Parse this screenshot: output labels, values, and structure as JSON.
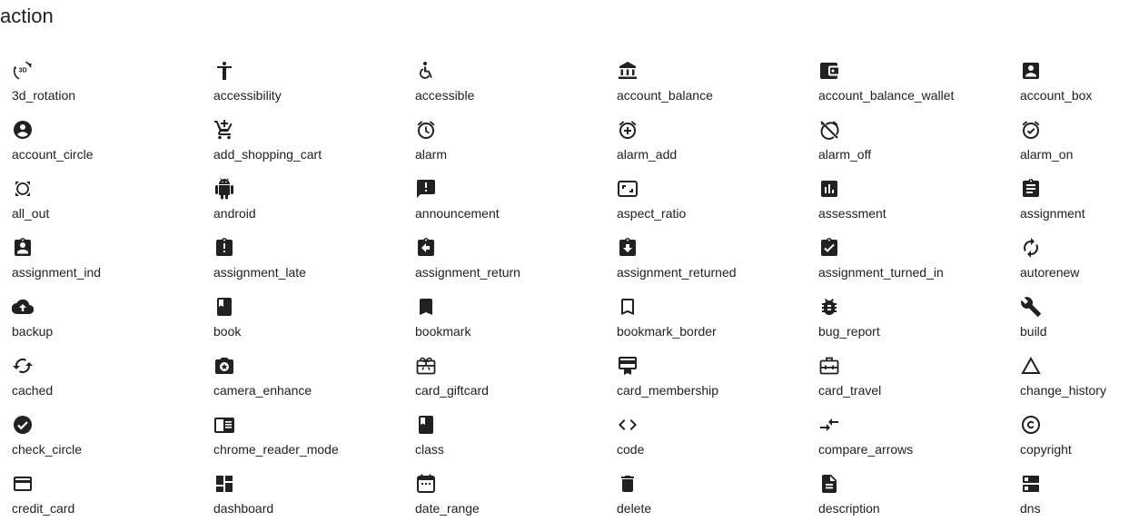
{
  "section": {
    "title": "action"
  },
  "icons": [
    {
      "label": "3d_rotation",
      "icon": "3d-rotation-icon"
    },
    {
      "label": "accessibility",
      "icon": "accessibility-icon"
    },
    {
      "label": "accessible",
      "icon": "accessible-icon"
    },
    {
      "label": "account_balance",
      "icon": "account-balance-icon"
    },
    {
      "label": "account_balance_wallet",
      "icon": "account-balance-wallet-icon"
    },
    {
      "label": "account_box",
      "icon": "account-box-icon"
    },
    {
      "label": "account_circle",
      "icon": "account-circle-icon"
    },
    {
      "label": "add_shopping_cart",
      "icon": "add-shopping-cart-icon"
    },
    {
      "label": "alarm",
      "icon": "alarm-icon"
    },
    {
      "label": "alarm_add",
      "icon": "alarm-add-icon"
    },
    {
      "label": "alarm_off",
      "icon": "alarm-off-icon"
    },
    {
      "label": "alarm_on",
      "icon": "alarm-on-icon"
    },
    {
      "label": "all_out",
      "icon": "all-out-icon"
    },
    {
      "label": "android",
      "icon": "android-icon"
    },
    {
      "label": "announcement",
      "icon": "announcement-icon"
    },
    {
      "label": "aspect_ratio",
      "icon": "aspect-ratio-icon"
    },
    {
      "label": "assessment",
      "icon": "assessment-icon"
    },
    {
      "label": "assignment",
      "icon": "assignment-icon"
    },
    {
      "label": "assignment_ind",
      "icon": "assignment-ind-icon"
    },
    {
      "label": "assignment_late",
      "icon": "assignment-late-icon"
    },
    {
      "label": "assignment_return",
      "icon": "assignment-return-icon"
    },
    {
      "label": "assignment_returned",
      "icon": "assignment-returned-icon"
    },
    {
      "label": "assignment_turned_in",
      "icon": "assignment-turned-in-icon"
    },
    {
      "label": "autorenew",
      "icon": "autorenew-icon"
    },
    {
      "label": "backup",
      "icon": "backup-icon"
    },
    {
      "label": "book",
      "icon": "book-icon"
    },
    {
      "label": "bookmark",
      "icon": "bookmark-icon"
    },
    {
      "label": "bookmark_border",
      "icon": "bookmark-border-icon"
    },
    {
      "label": "bug_report",
      "icon": "bug-report-icon"
    },
    {
      "label": "build",
      "icon": "build-icon"
    },
    {
      "label": "cached",
      "icon": "cached-icon"
    },
    {
      "label": "camera_enhance",
      "icon": "camera-enhance-icon"
    },
    {
      "label": "card_giftcard",
      "icon": "card-giftcard-icon"
    },
    {
      "label": "card_membership",
      "icon": "card-membership-icon"
    },
    {
      "label": "card_travel",
      "icon": "card-travel-icon"
    },
    {
      "label": "change_history",
      "icon": "change-history-icon"
    },
    {
      "label": "check_circle",
      "icon": "check-circle-icon"
    },
    {
      "label": "chrome_reader_mode",
      "icon": "chrome-reader-mode-icon"
    },
    {
      "label": "class",
      "icon": "class-icon"
    },
    {
      "label": "code",
      "icon": "code-icon"
    },
    {
      "label": "compare_arrows",
      "icon": "compare-arrows-icon"
    },
    {
      "label": "copyright",
      "icon": "copyright-icon"
    },
    {
      "label": "credit_card",
      "icon": "credit-card-icon"
    },
    {
      "label": "dashboard",
      "icon": "dashboard-icon"
    },
    {
      "label": "date_range",
      "icon": "date-range-icon"
    },
    {
      "label": "delete",
      "icon": "delete-icon"
    },
    {
      "label": "description",
      "icon": "description-icon"
    },
    {
      "label": "dns",
      "icon": "dns-icon"
    }
  ],
  "colors": {
    "icon": "#212121",
    "text": "#212121",
    "background": "#ffffff"
  }
}
